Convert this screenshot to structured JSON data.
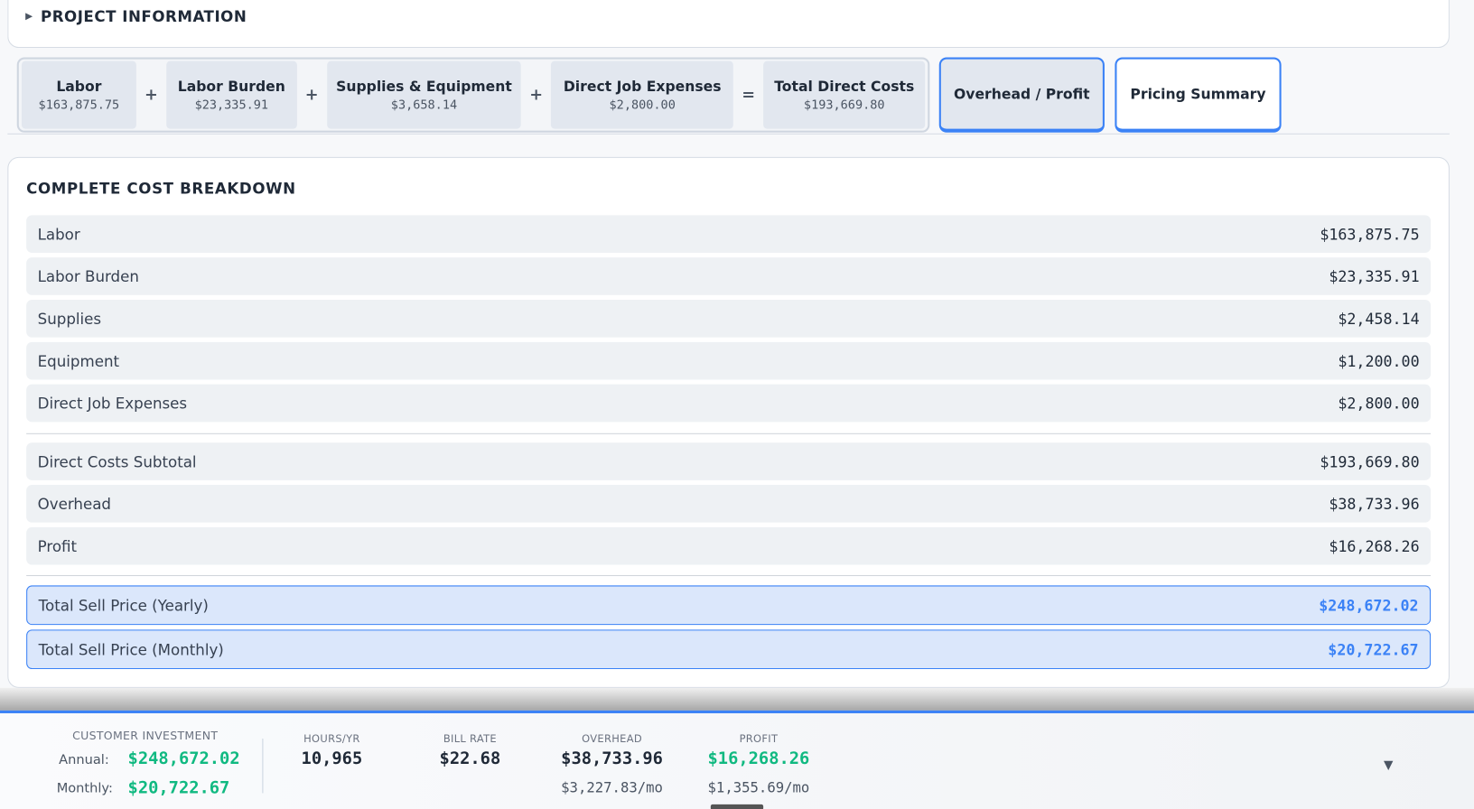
{
  "project": {
    "title": "PROJECT INFORMATION"
  },
  "formula": [
    {
      "label": "Labor",
      "value": "$163,875.75"
    },
    {
      "label": "Labor Burden",
      "value": "$23,335.91"
    },
    {
      "label": "Supplies & Equipment",
      "value": "$3,658.14"
    },
    {
      "label": "Direct Job Expenses",
      "value": "$2,800.00"
    },
    {
      "label": "Total Direct Costs",
      "value": "$193,669.80"
    }
  ],
  "ops": [
    "+",
    "+",
    "+",
    "="
  ],
  "tabs": {
    "overhead": "Overhead / Profit",
    "pricing": "Pricing Summary"
  },
  "breakdown": {
    "title": "COMPLETE COST BREAKDOWN",
    "rows": [
      {
        "label": "Labor",
        "value": "$163,875.75"
      },
      {
        "label": "Labor Burden",
        "value": "$23,335.91"
      },
      {
        "label": "Supplies",
        "value": "$2,458.14"
      },
      {
        "label": "Equipment",
        "value": "$1,200.00"
      },
      {
        "label": "Direct Job Expenses",
        "value": "$2,800.00"
      },
      {
        "label": "Direct Costs Subtotal",
        "value": "$193,669.80"
      },
      {
        "label": "Overhead",
        "value": "$38,733.96"
      },
      {
        "label": "Profit",
        "value": "$16,268.26"
      },
      {
        "label": "Total Sell Price (Yearly)",
        "value": "$248,672.02"
      },
      {
        "label": "Total Sell Price (Monthly)",
        "value": "$20,722.67"
      }
    ]
  },
  "footer": {
    "ci_label": "CUSTOMER INVESTMENT",
    "annual_label": "Annual:",
    "annual": "$248,672.02",
    "monthly_label": "Monthly:",
    "monthly": "$20,722.67",
    "hours_label": "HOURS/YR",
    "hours": "10,965",
    "rate_label": "BILL RATE",
    "rate": "$22.68",
    "overhead_label": "OVERHEAD",
    "overhead": "$38,733.96",
    "overhead_mo": "$3,227.83/mo",
    "profit_label": "PROFIT",
    "profit": "$16,268.26",
    "profit_mo": "$1,355.69/mo",
    "toggle": "▼"
  }
}
